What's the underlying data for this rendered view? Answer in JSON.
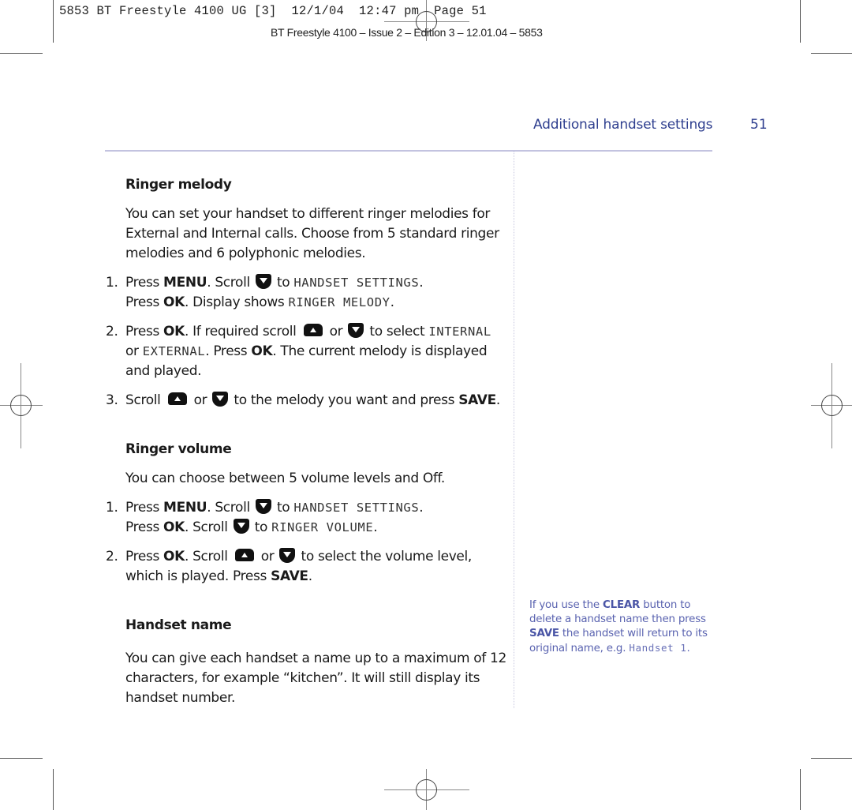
{
  "slug": {
    "line1": "5853 BT Freestyle 4100 UG [3]  12/1/04  12:47 pm  Page 51",
    "line2": "BT Freestyle 4100 – Issue 2 – Edition 3 – 12.01.04 – 5853"
  },
  "running_header": {
    "title": "Additional handset settings",
    "page_number": "51"
  },
  "colors": {
    "accent": "#2f3f8f",
    "note_text": "#5a63b0",
    "rule": "#c3c3e0"
  },
  "sections": [
    {
      "heading": "Ringer melody",
      "intro": "You can set your handset to different ringer melodies for External and Internal calls. Choose from 5 standard ringer melodies and 6 polyphonic melodies.",
      "steps": [
        {
          "num": "1.",
          "t1": "Press ",
          "b1": "MENU",
          "t2": ". Scroll ",
          "icon1": "scroll-down-key",
          "t3": " to ",
          "lcd1": "HANDSET SETTINGS",
          "t4": ".",
          "t5": "Press ",
          "b2": "OK",
          "t6": ". Display shows ",
          "lcd2": "RINGER MELODY",
          "t7": "."
        },
        {
          "num": "2.",
          "t1": "Press ",
          "b1": "OK",
          "t2": ". If required scroll ",
          "icon1": "scroll-up-key",
          "t3": " or ",
          "icon2": "scroll-down-key",
          "t4": " to select ",
          "lcd1": "INTERNAL",
          "t5": "or ",
          "lcd2": "EXTERNAL",
          "t6": ". Press ",
          "b2": "OK",
          "t7": ". The current melody is displayed and played."
        },
        {
          "num": "3.",
          "t1": "Scroll ",
          "icon1": "scroll-up-key",
          "t2": " or ",
          "icon2": "scroll-down-key",
          "t3": " to the melody you want and press ",
          "b1": "SAVE",
          "t4": "."
        }
      ]
    },
    {
      "heading": "Ringer volume",
      "intro": "You can choose between 5 volume levels and Off.",
      "steps": [
        {
          "num": "1.",
          "t1": "Press ",
          "b1": "MENU",
          "t2": ". Scroll ",
          "icon1": "scroll-down-key",
          "t3": " to ",
          "lcd1": "HANDSET SETTINGS",
          "t4": ".",
          "t5": "Press ",
          "b2": "OK",
          "t6": ". Scroll ",
          "icon2": "scroll-down-key",
          "t7": " to ",
          "lcd2": "RINGER VOLUME",
          "t8": "."
        },
        {
          "num": "2.",
          "t1": "Press ",
          "b1": "OK",
          "t2": ". Scroll ",
          "icon1": "scroll-up-key",
          "t3": " or ",
          "icon2": "scroll-down-key",
          "t4": " to select the volume level, which is played. Press ",
          "b2": "SAVE",
          "t5": "."
        }
      ]
    },
    {
      "heading": "Handset name",
      "intro": "You can give each handset a name up to a maximum of 12 characters, for example “kitchen”. It will still display its handset number."
    }
  ],
  "side_note": {
    "t1": "If you use the ",
    "b1": "CLEAR",
    "t2": " button to delete a handset name then press ",
    "b2": "SAVE",
    "t3": " the handset will return to its original name, e.g. ",
    "lcd1": "Handset 1",
    "t4": "."
  }
}
